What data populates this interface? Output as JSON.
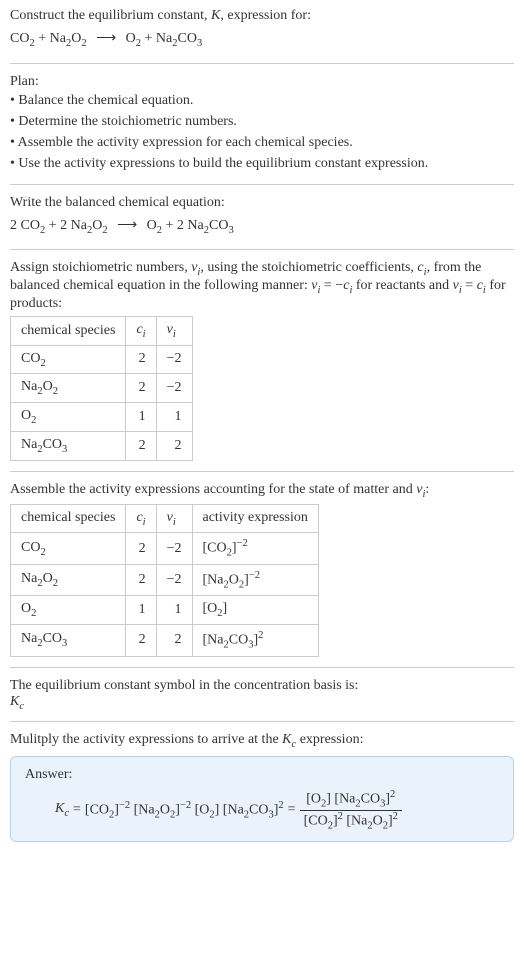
{
  "intro": {
    "line1": "Construct the equilibrium constant, ",
    "k": "K",
    "line1b": ", expression for:",
    "reactant1": "CO",
    "reactant1sub": "2",
    "plus": " + ",
    "reactant2": "Na",
    "reactant2sub": "2",
    "reactant2b": "O",
    "reactant2bsub": "2",
    "arrow": "⟶",
    "product1": "O",
    "product1sub": "2",
    "product2": "Na",
    "product2sub": "2",
    "product2b": "CO",
    "product2bsub": "3"
  },
  "plan": {
    "title": "Plan:",
    "items": [
      "Balance the chemical equation.",
      "Determine the stoichiometric numbers.",
      "Assemble the activity expression for each chemical species.",
      "Use the activity expressions to build the equilibrium constant expression."
    ]
  },
  "balanced": {
    "label": "Write the balanced chemical equation:",
    "c1": "2 ",
    "r1": "CO",
    "r1sub": "2",
    "c2": "2 ",
    "r2": "Na",
    "r2sub": "2",
    "r2b": "O",
    "r2bsub": "2",
    "p1": "O",
    "p1sub": "2",
    "c3": "2 ",
    "p2": "Na",
    "p2sub": "2",
    "p2b": "CO",
    "p2bsub": "3"
  },
  "stoich": {
    "text1": "Assign stoichiometric numbers, ",
    "nu": "ν",
    "isub": "i",
    "text2": ", using the stoichiometric coefficients, ",
    "c": "c",
    "text3": ", from the balanced chemical equation in the following manner: ",
    "eq1a": "ν",
    "eq1b": " = −",
    "eq1c": "c",
    "text4": " for reactants and ",
    "eq2a": "ν",
    "eq2b": " = ",
    "eq2c": "c",
    "text5": " for products:"
  },
  "table1": {
    "headers": {
      "species": "chemical species",
      "ci": "c",
      "cisub": "i",
      "nui": "ν",
      "nuisub": "i"
    },
    "rows": [
      {
        "species": "CO",
        "sub": "2",
        "ci": "2",
        "nui": "−2"
      },
      {
        "species": "Na",
        "sub1": "2",
        "mid": "O",
        "sub2": "2",
        "ci": "2",
        "nui": "−2"
      },
      {
        "species": "O",
        "sub": "2",
        "ci": "1",
        "nui": "1"
      },
      {
        "species": "Na",
        "sub1": "2",
        "mid": "CO",
        "sub2": "3",
        "ci": "2",
        "nui": "2"
      }
    ]
  },
  "activity": {
    "text1": "Assemble the activity expressions accounting for the state of matter and ",
    "nu": "ν",
    "isub": "i",
    "text2": ":"
  },
  "table2": {
    "headers": {
      "species": "chemical species",
      "ci": "c",
      "cisub": "i",
      "nui": "ν",
      "nuisub": "i",
      "activity": "activity expression"
    }
  },
  "concbasis": {
    "line1": "The equilibrium constant symbol in the concentration basis is:",
    "kc": "K",
    "kcsub": "c"
  },
  "multiply": {
    "text1": "Mulitply the activity expressions to arrive at the ",
    "kc": "K",
    "kcsub": "c",
    "text2": " expression:"
  },
  "answer": {
    "label": "Answer:",
    "eq": " = "
  }
}
